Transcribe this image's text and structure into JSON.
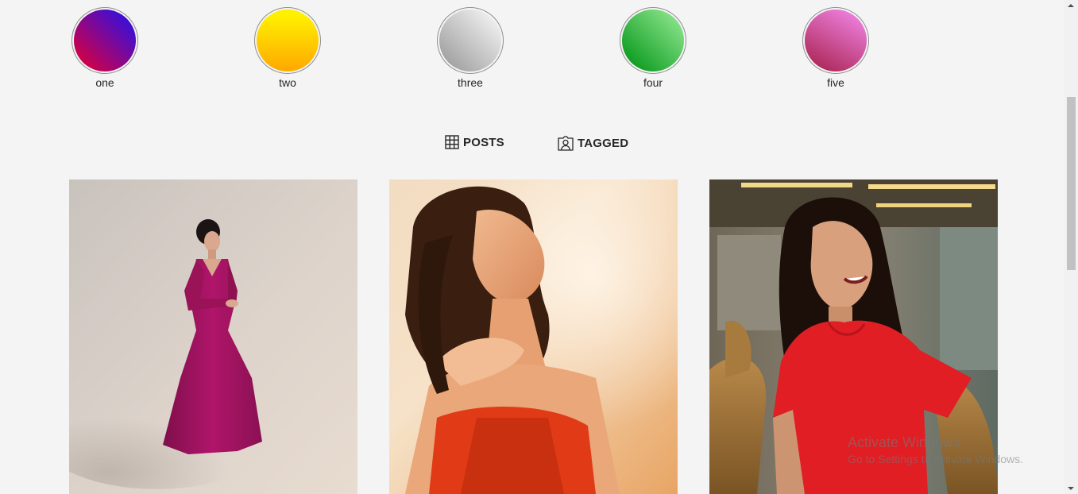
{
  "stories": [
    {
      "label": "one",
      "gradient": [
        "#3d0fd6",
        "#d7003f"
      ]
    },
    {
      "label": "two",
      "gradient": [
        "#ffe600",
        "#ffab00"
      ]
    },
    {
      "label": "three",
      "gradient": [
        "#e6e6e6",
        "#9a9a9a"
      ]
    },
    {
      "label": "four",
      "gradient": [
        "#7fe07f",
        "#0a9a1e"
      ]
    },
    {
      "label": "five",
      "gradient": [
        "#ea7ad6",
        "#a8234f"
      ]
    }
  ],
  "tabs": {
    "posts": {
      "label": "POSTS",
      "icon": "grid-icon"
    },
    "tagged": {
      "label": "TAGGED",
      "icon": "tagged-person-icon"
    }
  },
  "posts": [
    {
      "subject": "woman-in-magenta-gown"
    },
    {
      "subject": "woman-in-orange-dress-golden-light"
    },
    {
      "subject": "woman-in-red-tshirt-smiling"
    }
  ],
  "watermark": {
    "title": "Activate Windows",
    "subtitle": "Go to Settings to activate Windows."
  }
}
